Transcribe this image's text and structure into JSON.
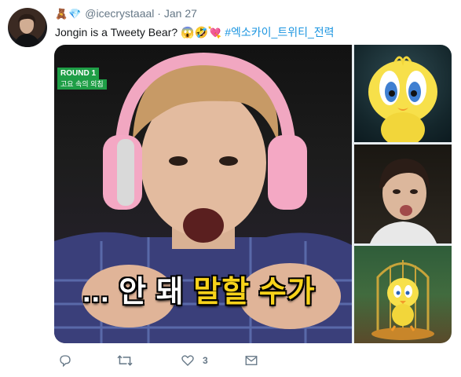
{
  "tweet": {
    "handle": "@icecrystaaal",
    "separator": "·",
    "date": "Jan 27",
    "name_emojis": [
      "🧸",
      "💎"
    ],
    "text": "Jongin is a Tweety Bear?",
    "text_emojis": "😱🤣💘",
    "hashtag": "#엑소카이_트위티_전력"
  },
  "media": {
    "main": {
      "badge_title": "ROUND 1",
      "badge_subtitle": "고요 속의 외침",
      "subtitle_white": "... 안 돼 ",
      "subtitle_yellow": "말할 수가"
    }
  },
  "actions": {
    "reply_icon": "reply-icon",
    "retweet_icon": "retweet-icon",
    "like_icon": "heart-icon",
    "like_count": "3",
    "dm_icon": "mail-icon"
  }
}
